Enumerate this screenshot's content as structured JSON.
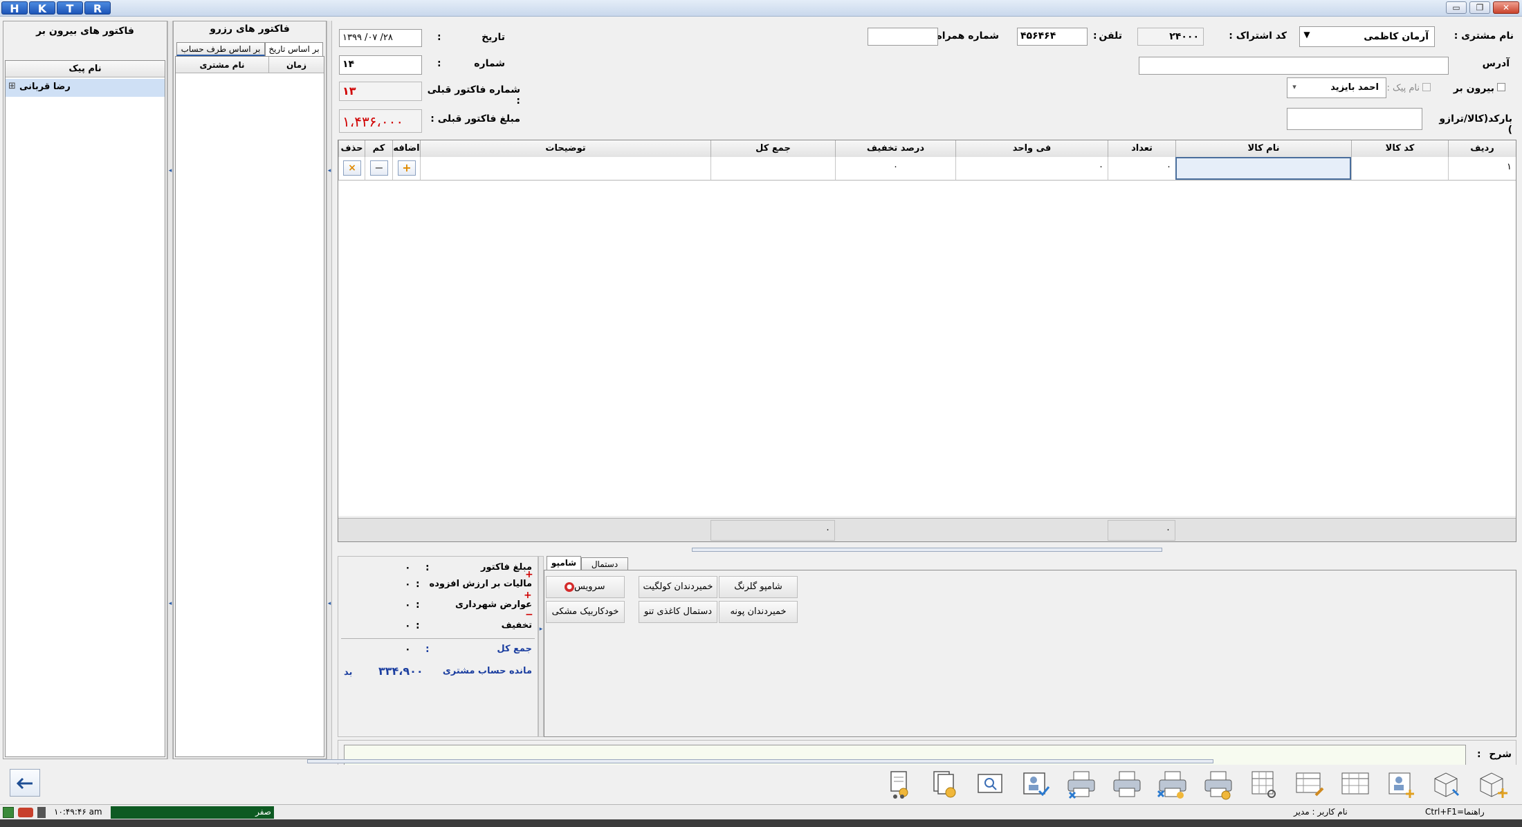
{
  "titlebar": {
    "logo_letters": [
      "H",
      "K",
      "T",
      "R"
    ],
    "minimize": "▭",
    "restore": "❐",
    "close": "✕"
  },
  "left_panel": {
    "title": "فاکتور های بیرون بر",
    "column_header": "نام پیک",
    "items": [
      {
        "expand": "⊞",
        "label": "رضا قربانی"
      }
    ]
  },
  "reserve_panel": {
    "title": "فاکتور های رزرو",
    "tabs": [
      "بر اساس تاریخ",
      "بر اساس طرف حساب"
    ],
    "columns": [
      "زمان",
      "نام مشتری"
    ]
  },
  "form": {
    "customer_name_label": "نام مشتری :",
    "customer_name_value": "آرمان کاظمی",
    "subscription_code_label": "کد اشتراک :",
    "subscription_code_value": "۲۴۰۰۰",
    "phone_label": "تلفن",
    "phone_value": "۴۵۶۴۶۴",
    "mobile_label": "شماره همراه :",
    "mobile_value": "",
    "date_label": "تاریخ",
    "date_value": "۱۳۹۹ /۰۷ /۲۸",
    "address_label": "آدرس",
    "address_value": "",
    "number_label": "شماره",
    "number_value": "۱۴",
    "takeout_label": "بیرون بر",
    "courier_label": "نام پیک :",
    "courier_value": "احمد بایزید",
    "prev_invoice_no_label": "شماره فاکتور قبلی :",
    "prev_invoice_no_value": "۱۳",
    "barcode_label": "بارکد(کالا/ترازو )",
    "barcode_value": "",
    "prev_invoice_amount_label": "مبلغ فاکتور قبلی :",
    "prev_invoice_amount_value": "۱،۴۳۶،۰۰۰",
    "colon": ":"
  },
  "grid": {
    "headers": {
      "row": "ردیف",
      "code": "کد کالا",
      "name": "نام کالا",
      "qty": "تعداد",
      "unit_price": "فی واحد",
      "discount": "درصد تخفیف",
      "total": "جمع کل",
      "desc": "توضیحات",
      "add": "اضافه",
      "less": "کم",
      "del": "حذف"
    },
    "rows": [
      {
        "row": "۱",
        "code": "",
        "name": "",
        "qty": "۰",
        "unit_price": "۰",
        "discount": "۰",
        "total": "",
        "desc": "",
        "add": "+",
        "less": "−",
        "del": "×"
      }
    ],
    "footer": {
      "qty_sum": "۰",
      "total_sum": "۰"
    }
  },
  "summary": {
    "invoice_amount_label": "مبلغ فاکتور",
    "invoice_amount_value": "۰",
    "vat_label": "مالیات بر ارزش افزوده",
    "vat_value": "۰",
    "municipal_label": "عوارض شهرداری",
    "municipal_value": "۰",
    "discount_label": "تخفیف",
    "discount_value": "۰",
    "total_label": "جمع کل",
    "total_value": "۰",
    "balance_label": "مانده حساب مشتری",
    "balance_value": "۳۳۴،۹۰۰",
    "balance_status": "بد",
    "plus": "+",
    "minus": "−",
    "colon": ":"
  },
  "products": {
    "tabs": [
      "شامپو",
      "دستمال"
    ],
    "buttons": [
      [
        "شامپو گلرنگ",
        "خمیردندان کولگیت",
        "سرویس"
      ],
      [
        "خمیردندان پونه",
        "دستمال کاغذی تنو",
        "خودکاربیک مشکی"
      ]
    ]
  },
  "description": {
    "label": "شرح",
    "colon": ":",
    "value": ""
  },
  "toolbar": {
    "icons": [
      "invoice-cart-icon",
      "invoice-coins-icon",
      "invoice-search-icon",
      "customer-check-icon",
      "print-cancel-icon",
      "print-icon",
      "print-remove-icon",
      "print-coins-icon",
      "calculator-icon",
      "table-edit-icon",
      "table-icon",
      "user-add-icon",
      "box-icon",
      "box-add-icon"
    ]
  },
  "statusbar": {
    "help": "راهنما=Ctrl+F1",
    "user": "نام کاربر : مدیر",
    "time": "۱۰:۴۹:۴۶ am",
    "progress_label": "صفر"
  },
  "colors": {
    "accent": "#2a5ca8",
    "red": "#d00000",
    "blue_text": "#1c3fa0",
    "selected": "#cfe0f5",
    "status_green": "#0d5a22"
  }
}
